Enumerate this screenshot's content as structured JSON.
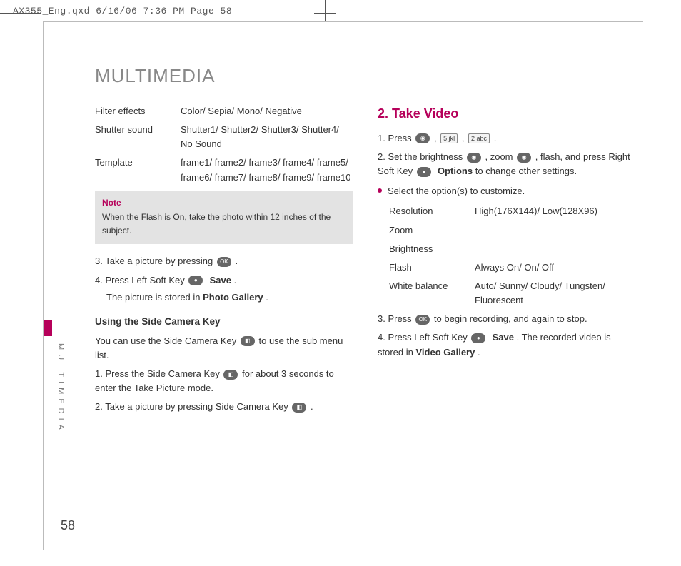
{
  "print_header": "AX355_Eng.qxd  6/16/06  7:36 PM  Page 58",
  "page_number": "58",
  "side_label": "MULTIMEDIA",
  "title": "MULTIMEDIA",
  "left": {
    "defs": [
      {
        "label": "Filter effects",
        "value": "Color/ Sepia/ Mono/ Negative"
      },
      {
        "label": "Shutter sound",
        "value": "Shutter1/ Shutter2/ Shutter3/ Shutter4/ No Sound"
      },
      {
        "label": "Template",
        "value": "frame1/ frame2/ frame3/ frame4/ frame5/ frame6/ frame7/ frame8/ frame9/ frame10"
      }
    ],
    "note_title": "Note",
    "note_body": "When the Flash is On, take the photo within 12 inches of the subject.",
    "step3_a": "3. Take a picture by pressing ",
    "step3_b": ".",
    "step4_a": "4. Press Left Soft Key ",
    "step4_bold": "Save",
    "step4_b": ".",
    "step4_sub_a": "The picture is stored in ",
    "step4_sub_bold": "Photo Gallery",
    "step4_sub_b": ".",
    "subhead": "Using the Side Camera Key",
    "side_intro_a": "You can use the Side Camera Key ",
    "side_intro_b": " to use the sub menu list.",
    "side_step1_a": "1. Press the Side Camera Key ",
    "side_step1_b": " for about 3 seconds to enter the Take Picture mode.",
    "side_step2_a": "2. Take a picture by pressing Side Camera Key ",
    "side_step2_b": "."
  },
  "right": {
    "section_title": "2. Take Video",
    "step1_a": "1. Press ",
    "step1_b": ", ",
    "step1_c": ", ",
    "step1_d": ".",
    "step2_a": "2. Set the brightness ",
    "step2_b": ", zoom ",
    "step2_c": ", flash, and press Right Soft Key ",
    "step2_bold": "Options",
    "step2_d": " to change other settings.",
    "bullet": "Select the option(s) to customize.",
    "defs": [
      {
        "label": "Resolution",
        "value": "High(176X144)/ Low(128X96)"
      },
      {
        "label": "Zoom",
        "value": ""
      },
      {
        "label": "Brightness",
        "value": ""
      },
      {
        "label": "Flash",
        "value": "Always On/ On/ Off"
      },
      {
        "label": "White balance",
        "value": "Auto/ Sunny/ Cloudy/ Tungsten/ Fluorescent"
      }
    ],
    "step3_a": "3. Press ",
    "step3_b": " to begin recording, and again to stop.",
    "step4_a": "4. Press Left Soft Key ",
    "step4_bold": "Save",
    "step4_b": ". The recorded video is stored in ",
    "step4_bold2": "Video Gallery",
    "step4_c": "."
  },
  "icons": {
    "ok": "OK",
    "softkey": "●",
    "key5": "5 jkl",
    "key2": "2 abc",
    "nav_lr": "◉",
    "nav_ud": "◉",
    "camera": "◧"
  }
}
